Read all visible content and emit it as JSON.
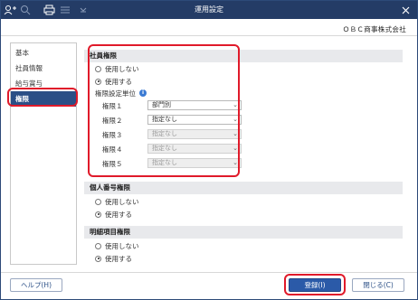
{
  "window": {
    "title": "運用設定"
  },
  "header": {
    "company": "ＯＢＣ商事株式会社"
  },
  "sidebar": {
    "items": [
      {
        "label": "基本",
        "active": false
      },
      {
        "label": "社員情報",
        "active": false
      },
      {
        "label": "給与賞与",
        "active": false
      },
      {
        "label": "権限",
        "active": true
      }
    ]
  },
  "sections": {
    "employee": {
      "title": "社員権限",
      "options": [
        "使用しない",
        "使用する"
      ],
      "selected": 1,
      "unit_label": "権限設定単位",
      "rows": [
        {
          "label": "権限１",
          "value": "部門別",
          "disabled": false
        },
        {
          "label": "権限２",
          "value": "指定なし",
          "disabled": false
        },
        {
          "label": "権限３",
          "value": "指定なし",
          "disabled": true
        },
        {
          "label": "権限４",
          "value": "指定なし",
          "disabled": true
        },
        {
          "label": "権限５",
          "value": "指定なし",
          "disabled": true
        }
      ]
    },
    "mynumber": {
      "title": "個人番号権限",
      "options": [
        "使用しない",
        "使用する"
      ],
      "selected": 1
    },
    "detail": {
      "title": "明細項目権限",
      "options": [
        "使用しない",
        "使用する"
      ],
      "selected": 1
    }
  },
  "buttons": {
    "help": "ヘルプ(H)",
    "register": "登録(I)",
    "close": "閉じる(C)"
  },
  "icons": [
    "person-add-icon",
    "search-icon",
    "print-icon",
    "settings-icon",
    "dropdown-icon",
    "close-icon",
    "info-icon"
  ]
}
